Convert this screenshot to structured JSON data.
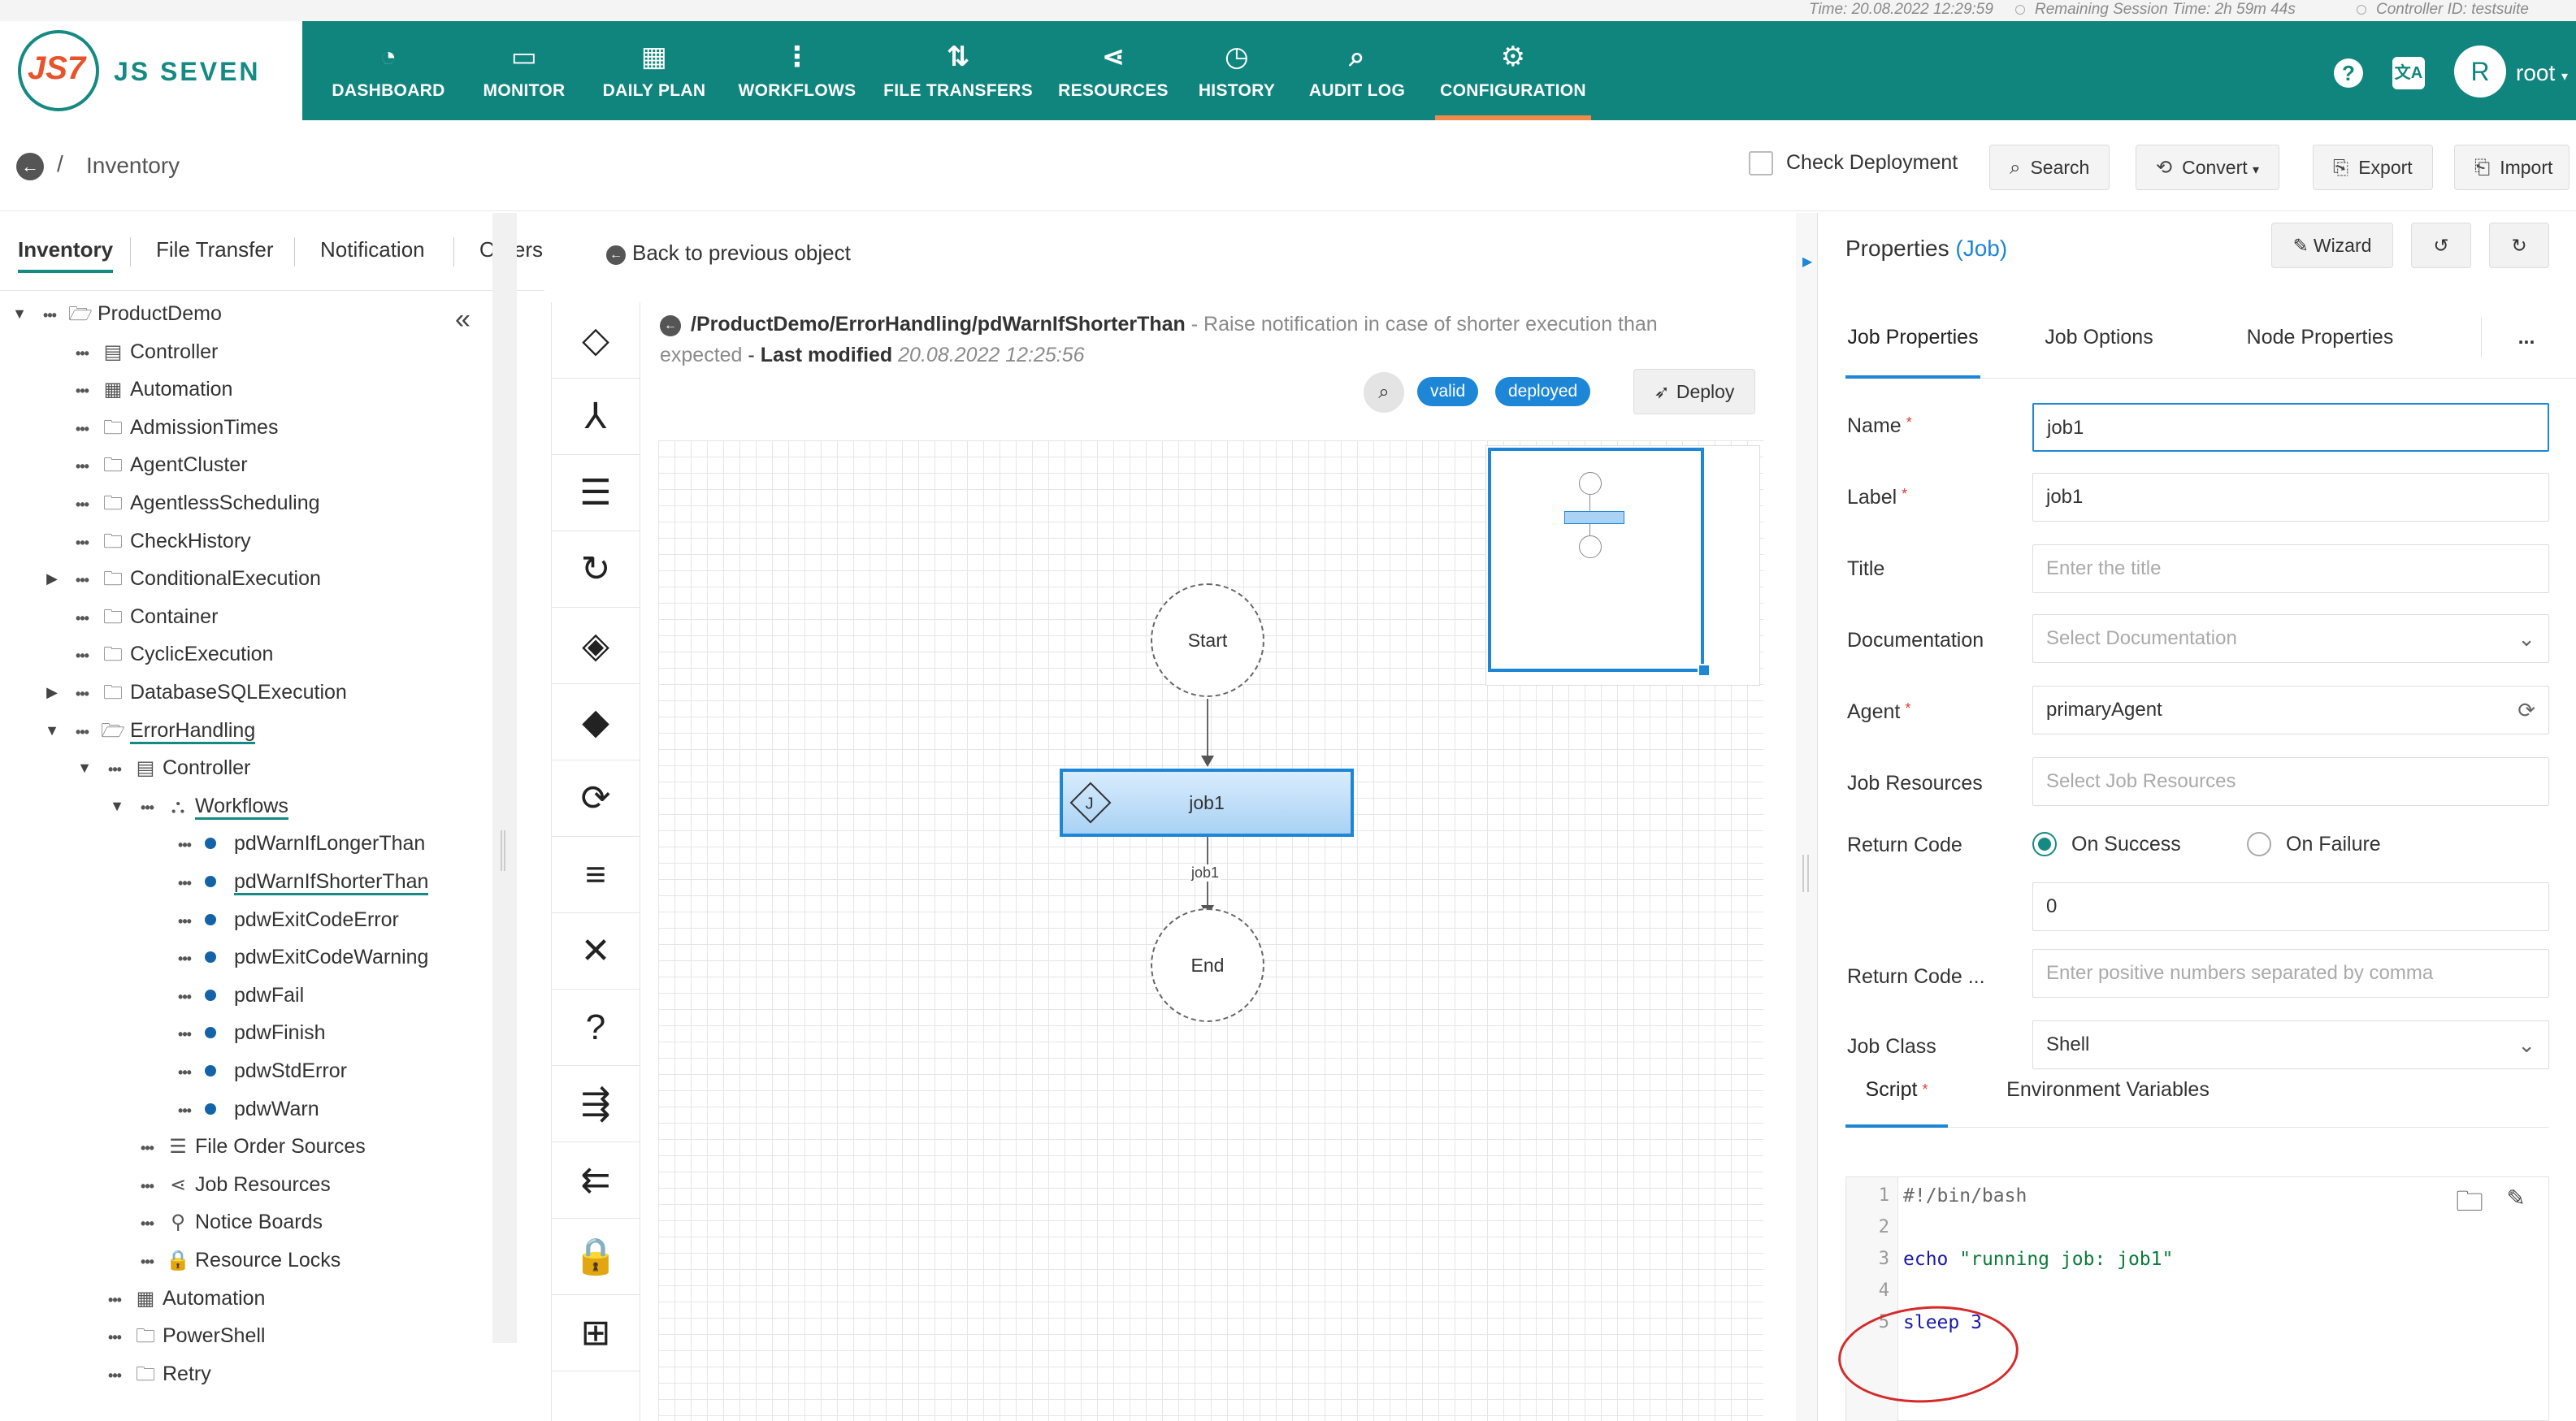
{
  "status_bar": {
    "time": "Time: 20.08.2022 12:29:59",
    "remaining": "Remaining Session Time: 2h 59m 44s",
    "controller": "Controller ID: testsuite"
  },
  "brand": {
    "logo_mark": "JS7",
    "name": "JS SEVEN"
  },
  "nav": {
    "items": [
      {
        "label": "DASHBOARD",
        "icon": "dashboard-icon"
      },
      {
        "label": "MONITOR",
        "icon": "monitor-icon"
      },
      {
        "label": "DAILY PLAN",
        "icon": "calendar-icon"
      },
      {
        "label": "WORKFLOWS",
        "icon": "workflow-icon"
      },
      {
        "label": "FILE TRANSFERS",
        "icon": "transfer-icon"
      },
      {
        "label": "RESOURCES",
        "icon": "share-icon"
      },
      {
        "label": "HISTORY",
        "icon": "clock-icon"
      },
      {
        "label": "AUDIT LOG",
        "icon": "audit-icon"
      },
      {
        "label": "CONFIGURATION",
        "icon": "gear-icon"
      }
    ],
    "active": "CONFIGURATION",
    "user_initial": "R",
    "user_name": "root"
  },
  "toolbar": {
    "breadcrumb_sep": "/",
    "breadcrumb": "Inventory",
    "check_deployment": "Check Deployment",
    "search": "Search",
    "convert": "Convert",
    "export": "Export",
    "import": "Import"
  },
  "left_tabs": [
    "Inventory",
    "File Transfer",
    "Notification",
    "Others"
  ],
  "back_link": "Back to previous object",
  "tree": [
    {
      "label": "ProductDemo",
      "level": 0,
      "icon": "folder-open",
      "caret": "down"
    },
    {
      "label": "Controller",
      "level": 1,
      "icon": "controller"
    },
    {
      "label": "Automation",
      "level": 1,
      "icon": "automation"
    },
    {
      "label": "AdmissionTimes",
      "level": 1,
      "icon": "folder"
    },
    {
      "label": "AgentCluster",
      "level": 1,
      "icon": "folder"
    },
    {
      "label": "AgentlessScheduling",
      "level": 1,
      "icon": "folder"
    },
    {
      "label": "CheckHistory",
      "level": 1,
      "icon": "folder"
    },
    {
      "label": "ConditionalExecution",
      "level": 1,
      "icon": "folder",
      "caret": "right"
    },
    {
      "label": "Container",
      "level": 1,
      "icon": "folder"
    },
    {
      "label": "CyclicExecution",
      "level": 1,
      "icon": "folder"
    },
    {
      "label": "DatabaseSQLExecution",
      "level": 1,
      "icon": "folder",
      "caret": "right"
    },
    {
      "label": "ErrorHandling",
      "level": 1,
      "icon": "folder-open",
      "caret": "down",
      "selected": true
    },
    {
      "label": "Controller",
      "level": 2,
      "icon": "controller",
      "caret": "down"
    },
    {
      "label": "Workflows",
      "level": 3,
      "icon": "workflows",
      "caret": "down",
      "selected": true
    },
    {
      "label": "pdWarnIfLongerThan",
      "level": 4,
      "icon": "bullet"
    },
    {
      "label": "pdWarnIfShorterThan",
      "level": 4,
      "icon": "bullet",
      "selected": true
    },
    {
      "label": "pdwExitCodeError",
      "level": 4,
      "icon": "bullet"
    },
    {
      "label": "pdwExitCodeWarning",
      "level": 4,
      "icon": "bullet"
    },
    {
      "label": "pdwFail",
      "level": 4,
      "icon": "bullet"
    },
    {
      "label": "pdwFinish",
      "level": 4,
      "icon": "bullet"
    },
    {
      "label": "pdwStdError",
      "level": 4,
      "icon": "bullet"
    },
    {
      "label": "pdwWarn",
      "level": 4,
      "icon": "bullet"
    },
    {
      "label": "File Order Sources",
      "level": 3,
      "icon": "list"
    },
    {
      "label": "Job Resources",
      "level": 3,
      "icon": "share"
    },
    {
      "label": "Notice Boards",
      "level": 3,
      "icon": "pin"
    },
    {
      "label": "Resource Locks",
      "level": 3,
      "icon": "lock"
    },
    {
      "label": "Automation",
      "level": 2,
      "icon": "automation"
    },
    {
      "label": "PowerShell",
      "level": 2,
      "icon": "folder"
    },
    {
      "label": "Retry",
      "level": 2,
      "icon": "folder"
    }
  ],
  "tools": [
    {
      "icon": "job-icon",
      "glyph": "◇"
    },
    {
      "icon": "fork-icon",
      "glyph": "⅄"
    },
    {
      "icon": "fork-list-icon",
      "glyph": "☰"
    },
    {
      "icon": "retry-icon",
      "glyph": "↻"
    },
    {
      "icon": "try-catch-icon",
      "glyph": "◈"
    },
    {
      "icon": "if-icon",
      "glyph": "◆"
    },
    {
      "icon": "cycle-icon",
      "glyph": "⟳"
    },
    {
      "icon": "finish-icon",
      "glyph": "≡"
    },
    {
      "icon": "fail-icon",
      "glyph": "✕"
    },
    {
      "icon": "question-icon",
      "glyph": "?"
    },
    {
      "icon": "post-notice-icon",
      "glyph": "⇶"
    },
    {
      "icon": "expect-notice-icon",
      "glyph": "⇇"
    },
    {
      "icon": "lock-icon",
      "glyph": "🔒"
    },
    {
      "icon": "add-order-icon",
      "glyph": "⊞"
    }
  ],
  "editor": {
    "path": "/ProductDemo/ErrorHandling/pdWarnIfShorterThan",
    "description": " - Raise notification in case of shorter execution than expected",
    "modified_label": "Last modified",
    "modified_time": "20.08.2022 12:25:56",
    "badge_valid": "valid",
    "badge_deployed": "deployed",
    "deploy": "Deploy"
  },
  "workflow": {
    "start": "Start",
    "job": "job1",
    "edge_label": "job1",
    "end": "End"
  },
  "properties": {
    "title": "Properties",
    "type": "(Job)",
    "wizard": "Wizard",
    "tabs": [
      "Job Properties",
      "Job Options",
      "Node Properties"
    ],
    "more": "...",
    "fields": {
      "name_label": "Name",
      "name_value": "job1",
      "label_label": "Label",
      "label_value": "job1",
      "title_label": "Title",
      "title_placeholder": "Enter the title",
      "doc_label": "Documentation",
      "doc_placeholder": "Select Documentation",
      "agent_label": "Agent",
      "agent_value": "primaryAgent",
      "jobres_label": "Job Resources",
      "jobres_placeholder": "Select Job Resources",
      "rc_label": "Return Code",
      "rc_success": "On Success",
      "rc_failure": "On Failure",
      "rc_value": "0",
      "rc2_label": "Return Code ...",
      "rc2_placeholder": "Enter positive numbers separated by comma",
      "jobclass_label": "Job Class",
      "jobclass_value": "Shell"
    },
    "script_tabs": [
      "Script",
      "Environment Variables"
    ],
    "script_lines": [
      {
        "n": "1",
        "text": "#!/bin/bash"
      },
      {
        "n": "2",
        "text": ""
      },
      {
        "n": "3",
        "text": "echo \"running job: job1\""
      },
      {
        "n": "4",
        "text": ""
      },
      {
        "n": "5",
        "text": "sleep 3"
      }
    ]
  },
  "colors": {
    "nav": "#10857e",
    "accent": "#1d86d6",
    "active_underline": "#f08a4b",
    "annotation": "#d62a2a"
  }
}
